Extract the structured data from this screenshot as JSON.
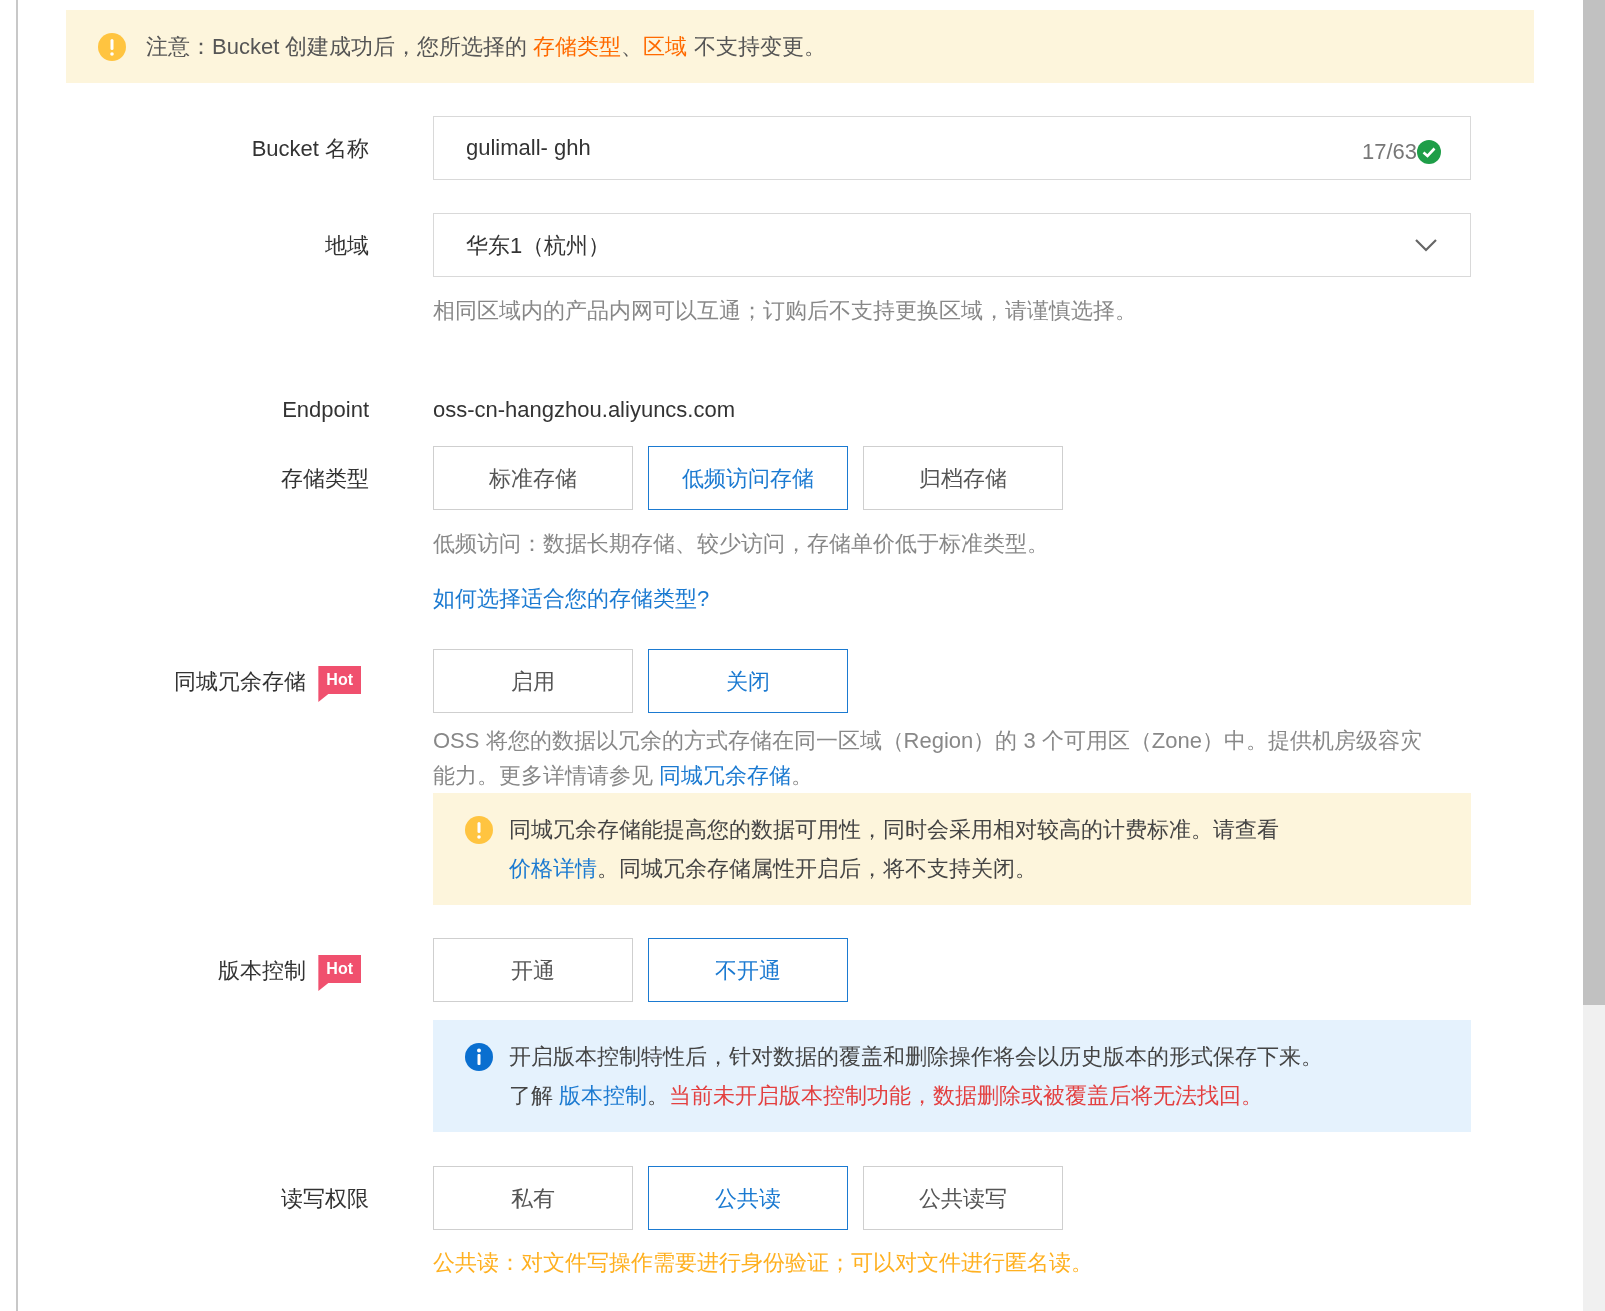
{
  "notice": {
    "segments": [
      {
        "kind": "text",
        "text": "注意：Bucket 创建成功后，您所选择的 "
      },
      {
        "kind": "highlight",
        "text": "存储类型"
      },
      {
        "kind": "text",
        "text": "、"
      },
      {
        "kind": "highlight",
        "text": "区域"
      },
      {
        "kind": "text",
        "text": " 不支持变更。"
      }
    ]
  },
  "bucket_name": {
    "label": "Bucket 名称",
    "value": "gulimall- ghh",
    "counter": "17/63",
    "valid": true
  },
  "region": {
    "label": "地域",
    "value": "华东1（杭州）",
    "hint": "相同区域内的产品内网可以互通；订购后不支持更换区域，请谨慎选择。"
  },
  "endpoint": {
    "label": "Endpoint",
    "value": "oss-cn-hangzhou.aliyuncs.com"
  },
  "storage_type": {
    "label": "存储类型",
    "options": [
      {
        "label": "标准存储",
        "selected": false
      },
      {
        "label": "低频访问存储",
        "selected": true
      },
      {
        "label": "归档存储",
        "selected": false
      }
    ],
    "hint": "低频访问：数据长期存储、较少访问，存储单价低于标准类型。",
    "link": "如何选择适合您的存储类型?"
  },
  "redundancy": {
    "label": "同城冗余存储",
    "badge": "Hot",
    "options": [
      {
        "label": "启用",
        "selected": false
      },
      {
        "label": "关闭",
        "selected": true
      }
    ],
    "description": [
      {
        "kind": "text",
        "text": "OSS 将您的数据以冗余的方式存储在同一区域（Region）的 3 个可用区（Zone）中。提供机房级容灾能力。更多详情请参见 "
      },
      {
        "kind": "link",
        "text": "同城冗余存储"
      },
      {
        "kind": "text",
        "text": "。"
      }
    ],
    "alert": {
      "kind": "warning",
      "segments": [
        {
          "kind": "text",
          "text": "同城冗余存储能提高您的数据可用性，同时会采用相对较高的计费标准。请查看 "
        },
        {
          "kind": "link",
          "text": "价格详情"
        },
        {
          "kind": "text",
          "text": "。同城冗余存储属性开启后，将不支持关闭。"
        }
      ]
    }
  },
  "versioning": {
    "label": "版本控制",
    "badge": "Hot",
    "options": [
      {
        "label": "开通",
        "selected": false
      },
      {
        "label": "不开通",
        "selected": true
      }
    ],
    "alert": {
      "kind": "info",
      "segments": [
        {
          "kind": "text",
          "text": "开启版本控制特性后，针对数据的覆盖和删除操作将会以历史版本的形式保存下来。了解 "
        },
        {
          "kind": "link",
          "text": "版本控制"
        },
        {
          "kind": "text",
          "text": "。"
        },
        {
          "kind": "danger",
          "text": "当前未开启版本控制功能，数据删除或被覆盖后将无法找回。"
        }
      ]
    }
  },
  "permission": {
    "label": "读写权限",
    "options": [
      {
        "label": "私有",
        "selected": false
      },
      {
        "label": "公共读",
        "selected": true
      },
      {
        "label": "公共读写",
        "selected": false
      }
    ],
    "hint": "公共读：对文件写操作需要进行身份验证；可以对文件进行匿名读。"
  }
}
